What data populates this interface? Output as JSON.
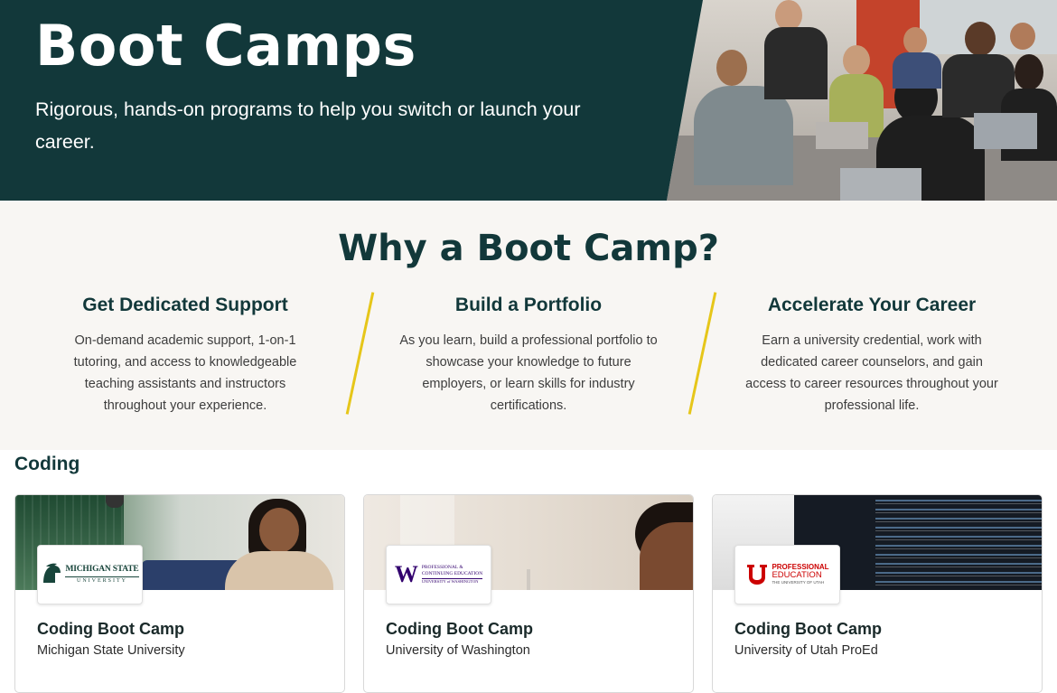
{
  "hero": {
    "title": "Boot Camps",
    "subtitle": "Rigorous, hands-on programs to help you switch or launch your career."
  },
  "why": {
    "title": "Why a Boot Camp?",
    "columns": [
      {
        "heading": "Get Dedicated Support",
        "body": "On-demand academic support, 1-on-1 tutoring, and access to knowledgeable teaching assistants and instructors throughout your experience."
      },
      {
        "heading": "Build a Portfolio",
        "body": "As you learn, build a professional portfolio to showcase your knowledge to future employers, or learn skills for industry certifications."
      },
      {
        "heading": "Accelerate Your Career",
        "body": "Earn a university credential, work with dedicated career counselors, and gain access to career resources throughout your professional life."
      }
    ]
  },
  "coding": {
    "heading": "Coding",
    "cards": [
      {
        "title": "Coding Boot Camp",
        "school": "Michigan State University",
        "logo_line1": "MICHIGAN STATE",
        "logo_line2": "UNIVERSITY"
      },
      {
        "title": "Coding Boot Camp",
        "school": "University of Washington",
        "logo_line1": "PROFESSIONAL &",
        "logo_line2": "CONTINUING EDUCATION",
        "logo_line3": "UNIVERSITY of WASHINGTON"
      },
      {
        "title": "Coding Boot Camp",
        "school": "University of Utah ProEd",
        "logo_line1": "PROFESSIONAL",
        "logo_line2": "EDUCATION",
        "logo_line3": "THE UNIVERSITY OF UTAH"
      }
    ]
  },
  "colors": {
    "brand_dark": "#12383a",
    "accent_yellow": "#e6c619",
    "msu_green": "#18453b",
    "uw_purple": "#32006e",
    "utah_red": "#cc0000"
  }
}
